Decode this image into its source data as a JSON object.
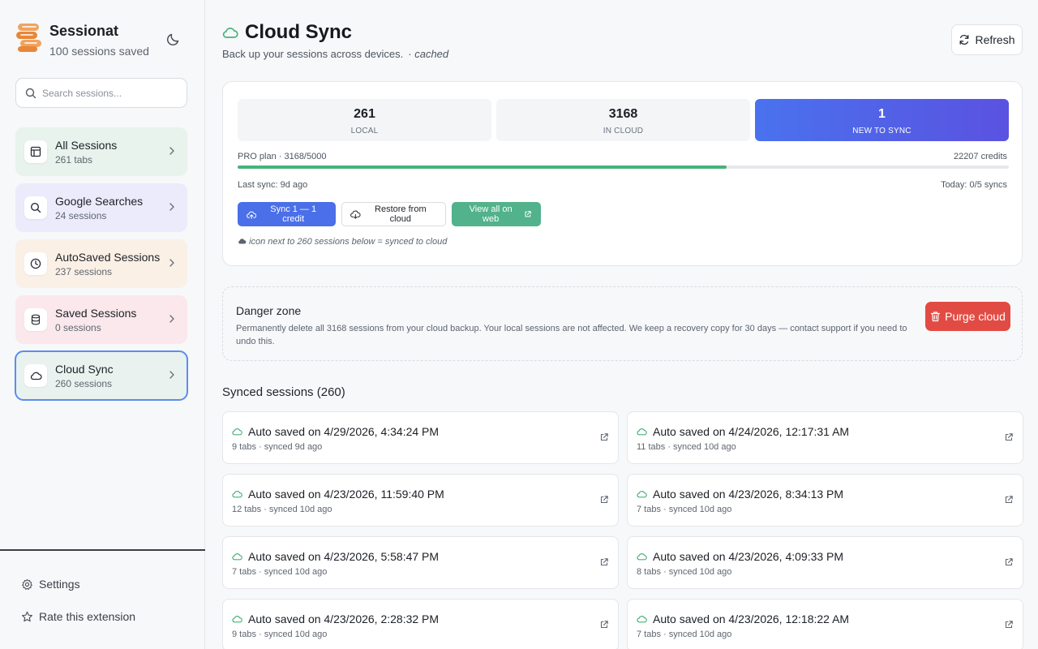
{
  "sidebar": {
    "brand_name": "Sessionat",
    "brand_sub": "100 sessions saved",
    "search_placeholder": "Search sessions...",
    "items": [
      {
        "title": "All Sessions",
        "sub": "261 tabs",
        "icon": "layout-icon",
        "bg": "#e7f3ec"
      },
      {
        "title": "Google Searches",
        "sub": "24 sessions",
        "icon": "search-icon",
        "bg": "#ebebfb"
      },
      {
        "title": "AutoSaved Sessions",
        "sub": "237 sessions",
        "icon": "clock-icon",
        "bg": "#fbf0e6"
      },
      {
        "title": "Saved Sessions",
        "sub": "0 sessions",
        "icon": "database-icon",
        "bg": "#fae8ec"
      },
      {
        "title": "Cloud Sync",
        "sub": "260 sessions",
        "icon": "cloud-icon",
        "bg": "#e9f2ef"
      }
    ],
    "settings_label": "Settings",
    "rate_label": "Rate this extension"
  },
  "header": {
    "title": "Cloud Sync",
    "subtitle": "Back up your sessions across devices.",
    "subtitle_tag": "· cached",
    "refresh_label": "Refresh"
  },
  "stats": {
    "local": {
      "value": "261",
      "label": "LOCAL"
    },
    "cloud": {
      "value": "3168",
      "label": "IN CLOUD"
    },
    "new": {
      "value": "1",
      "label": "NEW TO SYNC"
    }
  },
  "plan": {
    "label": "PRO plan · 3168/5000",
    "credits": "22207 credits",
    "usage_fraction": 0.6336,
    "last_sync": "Last sync: 9d ago",
    "today": "Today: 0/5 syncs"
  },
  "actions": {
    "sync_label": "Sync 1 — 1 credit",
    "restore_label": "Restore from cloud",
    "web_label": "View all on web"
  },
  "hint": "icon next to 260 sessions below = synced to cloud",
  "danger": {
    "title": "Danger zone",
    "description": "Permanently delete all 3168 sessions from your cloud backup. Your local sessions are not affected. We keep a recovery copy for 30 days — contact support if you need to undo this.",
    "purge_label": "Purge cloud"
  },
  "synced": {
    "title": "Synced sessions (260)",
    "sessions": [
      {
        "title": "Auto saved on 4/29/2026, 4:34:24 PM",
        "meta": "9 tabs · synced 9d ago"
      },
      {
        "title": "Auto saved on 4/24/2026, 12:17:31 AM",
        "meta": "11 tabs · synced 10d ago"
      },
      {
        "title": "Auto saved on 4/23/2026, 11:59:40 PM",
        "meta": "12 tabs · synced 10d ago"
      },
      {
        "title": "Auto saved on 4/23/2026, 8:34:13 PM",
        "meta": "7 tabs · synced 10d ago"
      },
      {
        "title": "Auto saved on 4/23/2026, 5:58:47 PM",
        "meta": "7 tabs · synced 10d ago"
      },
      {
        "title": "Auto saved on 4/23/2026, 4:09:33 PM",
        "meta": "8 tabs · synced 10d ago"
      },
      {
        "title": "Auto saved on 4/23/2026, 2:28:32 PM",
        "meta": "9 tabs · synced 10d ago"
      },
      {
        "title": "Auto saved on 4/23/2026, 12:18:22 AM",
        "meta": "7 tabs · synced 10d ago"
      }
    ]
  },
  "colors": {
    "accent": "#4a6fe8",
    "success": "#48b27a",
    "danger": "#e24b43",
    "active_border": "#5b8def"
  }
}
